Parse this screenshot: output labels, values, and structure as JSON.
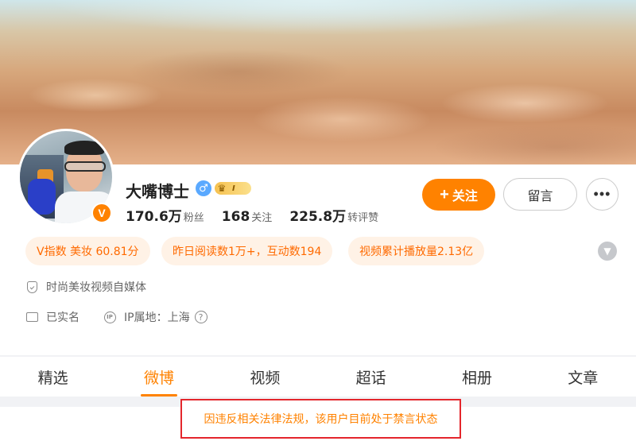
{
  "profile": {
    "name": "大嘴博士",
    "gender_symbol": "♂",
    "crown_symbol": "♛",
    "crown_level": "I",
    "verified_badge": "V"
  },
  "stats": [
    {
      "num": "170.6万",
      "label": "粉丝"
    },
    {
      "num": "168",
      "label": "关注"
    },
    {
      "num": "225.8万",
      "label": "转评赞"
    }
  ],
  "actions": {
    "follow_plus": "+",
    "follow_label": "关注",
    "message_label": "留言",
    "more_label": "•••"
  },
  "tags": [
    "V指数 美妆 60.81分",
    "昨日阅读数1万+，互动数194",
    "视频累计播放量2.13亿"
  ],
  "info": {
    "description": "时尚美妆视频自媒体",
    "verified": "已实名",
    "ip_label": "IP属地：上海",
    "help_symbol": "?"
  },
  "tabs": [
    "精选",
    "微博",
    "视频",
    "超话",
    "相册",
    "文章"
  ],
  "active_tab": "微博",
  "notice": "因违反相关法律法规，该用户目前处于禁言状态",
  "colors": {
    "accent": "#ff8200",
    "tag_bg": "#fff2e6",
    "notice_border": "#e4262c",
    "gender": "#5aa9ff"
  },
  "icons": {
    "expand": "chevron-down-icon",
    "description": "shield-icon",
    "verified": "id-card-icon",
    "ip": "ip-location-icon"
  }
}
